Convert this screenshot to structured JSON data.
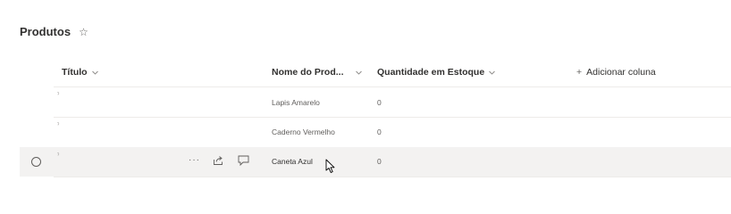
{
  "list": {
    "title": "Produtos",
    "favorite_icon": "star-outline-icon"
  },
  "columns": [
    {
      "label": "Título",
      "has_chevron": true
    },
    {
      "label": "Nome do Prod...",
      "has_chevron": true
    },
    {
      "label": "Quantidade em Estoque",
      "has_chevron": true
    }
  ],
  "add_column": {
    "label": "Adicionar coluna",
    "icon": "plus-icon"
  },
  "rows": [
    {
      "title": "ˀ",
      "nome": "Lapis Amarelo",
      "quantidade": "0"
    },
    {
      "title": "ˀ",
      "nome": "Caderno Vermelho",
      "quantidade": "0"
    },
    {
      "title": "ˀ",
      "nome": "Caneta Azul",
      "quantidade": "0",
      "hovered": true
    }
  ],
  "row_actions": {
    "more": "···",
    "share_icon": "share-icon",
    "comment_icon": "comment-icon"
  }
}
